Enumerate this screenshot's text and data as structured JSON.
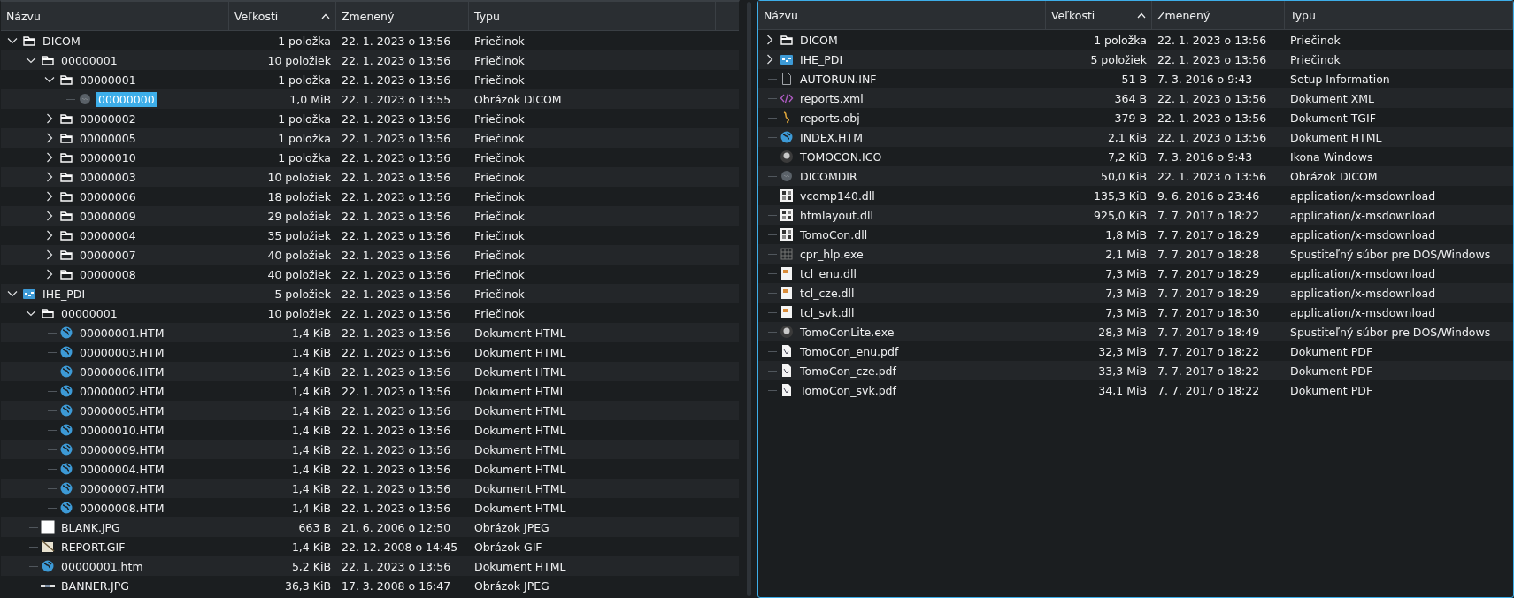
{
  "panes": [
    {
      "focused": false,
      "columns": [
        {
          "label": "Názvu",
          "sorted": false
        },
        {
          "label": "Veľkosti",
          "sorted": true
        },
        {
          "label": "Zmenený",
          "sorted": false
        },
        {
          "label": "Typu",
          "sorted": false
        }
      ],
      "items": [
        {
          "kind": "folder",
          "name": "DICOM",
          "size": "1 položka",
          "modified": "22. 1. 2023 o 13:56",
          "type": "Priečinok",
          "expanded": true,
          "selected": false,
          "children": [
            {
              "kind": "folder",
              "name": "00000001",
              "size": "10 položiek",
              "modified": "22. 1. 2023 o 13:56",
              "type": "Priečinok",
              "expanded": true,
              "selected": false,
              "children": [
                {
                  "kind": "folder",
                  "name": "00000001",
                  "size": "1 položka",
                  "modified": "22. 1. 2023 o 13:56",
                  "type": "Priečinok",
                  "expanded": true,
                  "selected": false,
                  "children": [
                    {
                      "kind": "dicom",
                      "name": "00000000",
                      "size": "1,0 MiB",
                      "modified": "22. 1. 2023 o 13:55",
                      "type": "Obrázok DICOM",
                      "selected": true
                    }
                  ]
                },
                {
                  "kind": "folder",
                  "name": "00000002",
                  "size": "1 položka",
                  "modified": "22. 1. 2023 o 13:56",
                  "type": "Priečinok",
                  "expanded": false,
                  "selected": false
                },
                {
                  "kind": "folder",
                  "name": "00000005",
                  "size": "1 položka",
                  "modified": "22. 1. 2023 o 13:56",
                  "type": "Priečinok",
                  "expanded": false,
                  "selected": false
                },
                {
                  "kind": "folder",
                  "name": "00000010",
                  "size": "1 položka",
                  "modified": "22. 1. 2023 o 13:56",
                  "type": "Priečinok",
                  "expanded": false,
                  "selected": false
                },
                {
                  "kind": "folder",
                  "name": "00000003",
                  "size": "10 položiek",
                  "modified": "22. 1. 2023 o 13:56",
                  "type": "Priečinok",
                  "expanded": false,
                  "selected": false
                },
                {
                  "kind": "folder",
                  "name": "00000006",
                  "size": "18 položiek",
                  "modified": "22. 1. 2023 o 13:56",
                  "type": "Priečinok",
                  "expanded": false,
                  "selected": false
                },
                {
                  "kind": "folder",
                  "name": "00000009",
                  "size": "29 položiek",
                  "modified": "22. 1. 2023 o 13:56",
                  "type": "Priečinok",
                  "expanded": false,
                  "selected": false
                },
                {
                  "kind": "folder",
                  "name": "00000004",
                  "size": "35 položiek",
                  "modified": "22. 1. 2023 o 13:56",
                  "type": "Priečinok",
                  "expanded": false,
                  "selected": false
                },
                {
                  "kind": "folder",
                  "name": "00000007",
                  "size": "40 položiek",
                  "modified": "22. 1. 2023 o 13:56",
                  "type": "Priečinok",
                  "expanded": false,
                  "selected": false
                },
                {
                  "kind": "folder",
                  "name": "00000008",
                  "size": "40 položiek",
                  "modified": "22. 1. 2023 o 13:56",
                  "type": "Priečinok",
                  "expanded": false,
                  "selected": false
                }
              ]
            }
          ]
        },
        {
          "kind": "webfolder",
          "name": "IHE_PDI",
          "size": "5 položiek",
          "modified": "22. 1. 2023 o 13:56",
          "type": "Priečinok",
          "expanded": true,
          "selected": false,
          "children": [
            {
              "kind": "folder",
              "name": "00000001",
              "size": "10 položiek",
              "modified": "22. 1. 2023 o 13:56",
              "type": "Priečinok",
              "expanded": true,
              "selected": false,
              "children": [
                {
                  "kind": "html",
                  "name": "00000001.HTM",
                  "size": "1,4 KiB",
                  "modified": "22. 1. 2023 o 13:56",
                  "type": "Dokument HTML",
                  "selected": false
                },
                {
                  "kind": "html",
                  "name": "00000003.HTM",
                  "size": "1,4 KiB",
                  "modified": "22. 1. 2023 o 13:56",
                  "type": "Dokument HTML",
                  "selected": false
                },
                {
                  "kind": "html",
                  "name": "00000006.HTM",
                  "size": "1,4 KiB",
                  "modified": "22. 1. 2023 o 13:56",
                  "type": "Dokument HTML",
                  "selected": false
                },
                {
                  "kind": "html",
                  "name": "00000002.HTM",
                  "size": "1,4 KiB",
                  "modified": "22. 1. 2023 o 13:56",
                  "type": "Dokument HTML",
                  "selected": false
                },
                {
                  "kind": "html",
                  "name": "00000005.HTM",
                  "size": "1,4 KiB",
                  "modified": "22. 1. 2023 o 13:56",
                  "type": "Dokument HTML",
                  "selected": false
                },
                {
                  "kind": "html",
                  "name": "00000010.HTM",
                  "size": "1,4 KiB",
                  "modified": "22. 1. 2023 o 13:56",
                  "type": "Dokument HTML",
                  "selected": false
                },
                {
                  "kind": "html",
                  "name": "00000009.HTM",
                  "size": "1,4 KiB",
                  "modified": "22. 1. 2023 o 13:56",
                  "type": "Dokument HTML",
                  "selected": false
                },
                {
                  "kind": "html",
                  "name": "00000004.HTM",
                  "size": "1,4 KiB",
                  "modified": "22. 1. 2023 o 13:56",
                  "type": "Dokument HTML",
                  "selected": false
                },
                {
                  "kind": "html",
                  "name": "00000007.HTM",
                  "size": "1,4 KiB",
                  "modified": "22. 1. 2023 o 13:56",
                  "type": "Dokument HTML",
                  "selected": false
                },
                {
                  "kind": "html",
                  "name": "00000008.HTM",
                  "size": "1,4 KiB",
                  "modified": "22. 1. 2023 o 13:56",
                  "type": "Dokument HTML",
                  "selected": false
                }
              ]
            },
            {
              "kind": "blank",
              "name": "BLANK.JPG",
              "size": "663 B",
              "modified": "21. 6. 2006 o 12:50",
              "type": "Obrázok JPEG",
              "selected": false
            },
            {
              "kind": "gif",
              "name": "REPORT.GIF",
              "size": "1,4 KiB",
              "modified": "22. 12. 2008 o 14:45",
              "type": "Obrázok GIF",
              "selected": false
            },
            {
              "kind": "html",
              "name": "00000001.htm",
              "size": "5,2 KiB",
              "modified": "22. 1. 2023 o 13:56",
              "type": "Dokument HTML",
              "selected": false
            },
            {
              "kind": "banner",
              "name": "BANNER.JPG",
              "size": "36,3 KiB",
              "modified": "17. 3. 2008 o 16:47",
              "type": "Obrázok JPEG",
              "selected": false
            }
          ]
        }
      ]
    },
    {
      "focused": true,
      "columns": [
        {
          "label": "Názvu",
          "sorted": false
        },
        {
          "label": "Veľkosti",
          "sorted": true
        },
        {
          "label": "Zmenený",
          "sorted": false
        },
        {
          "label": "Typu",
          "sorted": false
        }
      ],
      "items": [
        {
          "kind": "folder",
          "name": "DICOM",
          "size": "1 položka",
          "modified": "22. 1. 2023 o 13:56",
          "type": "Priečinok",
          "expanded": false,
          "selected": false
        },
        {
          "kind": "webfolder",
          "name": "IHE_PDI",
          "size": "5 položiek",
          "modified": "22. 1. 2023 o 13:56",
          "type": "Priečinok",
          "expanded": false,
          "selected": false
        },
        {
          "kind": "file",
          "name": "AUTORUN.INF",
          "size": "51 B",
          "modified": "7. 3. 2016 o 9:43",
          "type": "Setup Information",
          "selected": false
        },
        {
          "kind": "xml",
          "name": "reports.xml",
          "size": "364 B",
          "modified": "22. 1. 2023 o 13:56",
          "type": "Dokument XML",
          "selected": false
        },
        {
          "kind": "obj",
          "name": "reports.obj",
          "size": "379 B",
          "modified": "22. 1. 2023 o 13:56",
          "type": "Dokument TGIF",
          "selected": false
        },
        {
          "kind": "html",
          "name": "INDEX.HTM",
          "size": "2,1 KiB",
          "modified": "22. 1. 2023 o 13:56",
          "type": "Dokument HTML",
          "selected": false
        },
        {
          "kind": "app",
          "name": "TOMOCON.ICO",
          "size": "7,2 KiB",
          "modified": "7. 3. 2016 o 9:43",
          "type": "Ikona Windows",
          "selected": false
        },
        {
          "kind": "dicom",
          "name": "DICOMDIR",
          "size": "50,0 KiB",
          "modified": "22. 1. 2023 o 13:56",
          "type": "Obrázok DICOM",
          "selected": false
        },
        {
          "kind": "dll",
          "name": "vcomp140.dll",
          "size": "135,3 KiB",
          "modified": "9. 6. 2016 o 23:46",
          "type": "application/x-msdownload",
          "selected": false
        },
        {
          "kind": "dll",
          "name": "htmlayout.dll",
          "size": "925,0 KiB",
          "modified": "7. 7. 2017 o 18:22",
          "type": "application/x-msdownload",
          "selected": false
        },
        {
          "kind": "dll",
          "name": "TomoCon.dll",
          "size": "1,8 MiB",
          "modified": "7. 7. 2017 o 18:29",
          "type": "application/x-msdownload",
          "selected": false
        },
        {
          "kind": "exe",
          "name": "cpr_hlp.exe",
          "size": "2,1 MiB",
          "modified": "7. 7. 2017 o 18:28",
          "type": "Spustiteľný súbor pre DOS/Windows",
          "selected": false
        },
        {
          "kind": "lib",
          "name": "tcl_enu.dll",
          "size": "7,3 MiB",
          "modified": "7. 7. 2017 o 18:29",
          "type": "application/x-msdownload",
          "selected": false
        },
        {
          "kind": "lib",
          "name": "tcl_cze.dll",
          "size": "7,3 MiB",
          "modified": "7. 7. 2017 o 18:29",
          "type": "application/x-msdownload",
          "selected": false
        },
        {
          "kind": "lib",
          "name": "tcl_svk.dll",
          "size": "7,3 MiB",
          "modified": "7. 7. 2017 o 18:30",
          "type": "application/x-msdownload",
          "selected": false
        },
        {
          "kind": "app",
          "name": "TomoConLite.exe",
          "size": "28,3 MiB",
          "modified": "7. 7. 2017 o 18:49",
          "type": "Spustiteľný súbor pre DOS/Windows",
          "selected": false
        },
        {
          "kind": "pdf",
          "name": "TomoCon_enu.pdf",
          "size": "32,3 MiB",
          "modified": "7. 7. 2017 o 18:22",
          "type": "Dokument PDF",
          "selected": false
        },
        {
          "kind": "pdf",
          "name": "TomoCon_cze.pdf",
          "size": "33,3 MiB",
          "modified": "7. 7. 2017 o 18:22",
          "type": "Dokument PDF",
          "selected": false
        },
        {
          "kind": "pdf",
          "name": "TomoCon_svk.pdf",
          "size": "34,1 MiB",
          "modified": "7. 7. 2017 o 18:22",
          "type": "Dokument PDF",
          "selected": false
        }
      ]
    }
  ]
}
